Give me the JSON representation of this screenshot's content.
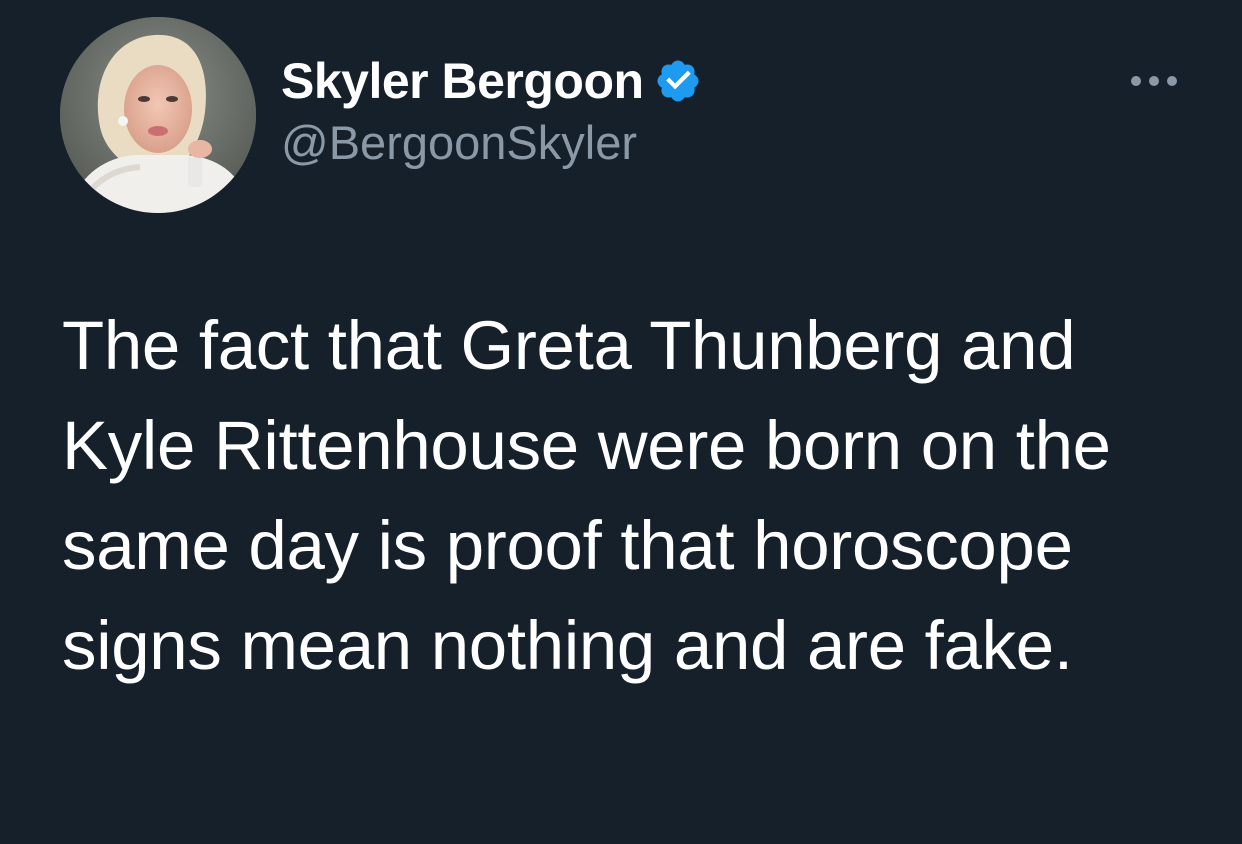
{
  "tweet": {
    "author": {
      "display_name": "Skyler Bergoon",
      "handle": "@BergoonSkyler",
      "verified": true,
      "avatar_icon": "profile-photo",
      "verified_icon": "verified-badge-icon",
      "verified_color": "#1d9bf0"
    },
    "more_icon": "more-options-icon",
    "text": "The fact that Greta Thunberg and Kyle Rittenhouse were born on the same day is proof that horoscope signs mean nothing and are fake."
  },
  "colors": {
    "background": "#15202b",
    "primary_text": "#ffffff",
    "secondary_text": "#8b98a5"
  }
}
